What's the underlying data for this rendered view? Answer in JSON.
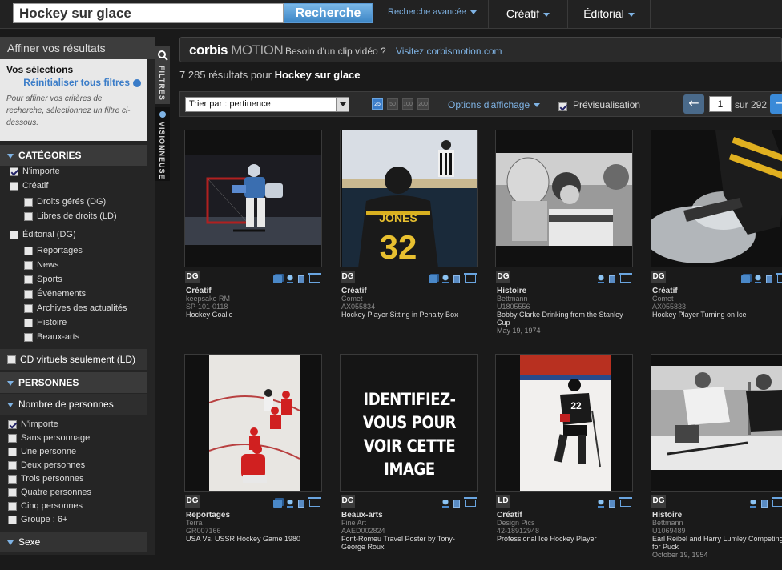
{
  "top": {
    "search_value": "Hockey sur glace",
    "search_button": "Recherche",
    "advanced": "Recherche avancée",
    "nav_creative": "Créatif",
    "nav_editorial": "Éditorial"
  },
  "sidebar": {
    "title": "Affiner vos résultats",
    "selections_title": "Vos sélections",
    "reset": "Réinitialiser tous filtres",
    "hint": "Pour affiner vos critères de recherche, sélectionnez un filtre ci-dessous.",
    "categories_head": "CATÉGORIES",
    "categories": [
      {
        "label": "N'importe",
        "checked": true
      },
      {
        "label": "Créatif",
        "checked": false
      },
      {
        "label": "Droits gérés (DG)",
        "checked": false
      },
      {
        "label": "Libres de droits (LD)",
        "checked": false
      },
      {
        "label": "Éditorial (DG)",
        "checked": false
      },
      {
        "label": "Reportages",
        "checked": false
      },
      {
        "label": "News",
        "checked": false
      },
      {
        "label": "Sports",
        "checked": false
      },
      {
        "label": "Événements",
        "checked": false
      },
      {
        "label": "Archives des actualités",
        "checked": false
      },
      {
        "label": "Histoire",
        "checked": false
      },
      {
        "label": "Beaux-arts",
        "checked": false
      }
    ],
    "cd_label": "CD virtuels seulement (LD)",
    "people_head": "PERSONNES",
    "people_count_head": "Nombre de personnes",
    "people": [
      {
        "label": "N'importe",
        "checked": true
      },
      {
        "label": "Sans personnage",
        "checked": false
      },
      {
        "label": "Une personne",
        "checked": false
      },
      {
        "label": "Deux personnes",
        "checked": false
      },
      {
        "label": "Trois personnes",
        "checked": false
      },
      {
        "label": "Quatre personnes",
        "checked": false
      },
      {
        "label": "Cinq personnes",
        "checked": false
      },
      {
        "label": "Groupe : 6+",
        "checked": false
      }
    ],
    "sex_head": "Sexe",
    "tab_filters": "FILTRES",
    "tab_viewer": "VISIONNEUSE"
  },
  "motion": {
    "brand_bold": "corbis",
    "brand_light": "MOTION",
    "need": "Besoin d'un clip vidéo ?",
    "visit": "Visitez corbismotion.com"
  },
  "results": {
    "count": "7 285",
    "mid": "résultats pour",
    "query": "Hockey sur glace"
  },
  "toolbar": {
    "sort": "Trier par : pertinence",
    "per_page": [
      "25",
      "50",
      "100",
      "200"
    ],
    "per_page_selected": "25",
    "display_options": "Options d'affichage",
    "preview": "Prévisualisation",
    "preview_checked": true,
    "page": "1",
    "of": "sur 292"
  },
  "cards": [
    {
      "badge": "DG",
      "category": "Créatif",
      "source": "keepsake RM",
      "id": "SP-101-0118",
      "title": "Hockey Goalie",
      "date": "",
      "icons": [
        "stack",
        "bulb",
        "calc",
        "cart"
      ]
    },
    {
      "badge": "DG",
      "category": "Créatif",
      "source": "Comet",
      "id": "AX055834",
      "title": "Hockey Player Sitting in Penalty Box",
      "date": "",
      "icons": [
        "stack",
        "bulb",
        "calc",
        "cart"
      ]
    },
    {
      "badge": "DG",
      "category": "Histoire",
      "source": "Bettmann",
      "id": "U1805556",
      "title": "Bobby Clarke Drinking from the Stanley Cup",
      "date": "May 19, 1974",
      "icons": [
        "bulb",
        "calc",
        "cart"
      ]
    },
    {
      "badge": "DG",
      "category": "Créatif",
      "source": "Comet",
      "id": "AX055833",
      "title": "Hockey Player Turning on Ice",
      "date": "",
      "icons": [
        "stack",
        "bulb",
        "calc",
        "cart"
      ]
    },
    {
      "badge": "DG",
      "category": "Reportages",
      "source": "Terra",
      "id": "GR007166",
      "title": "USA Vs. USSR Hockey Game 1980",
      "date": "",
      "icons": [
        "stack",
        "bulb",
        "calc",
        "cart"
      ]
    },
    {
      "badge": "DG",
      "category": "Beaux-arts",
      "source": "Fine Art",
      "id": "AAED002824",
      "title": "Font-Romeu Travel Poster by Tony-George Roux",
      "date": "",
      "icons": [
        "bulb",
        "calc",
        "cart"
      ],
      "locked_text": "IDENTIFIEZ-VOUS POUR VOIR CETTE IMAGE"
    },
    {
      "badge": "LD",
      "category": "Créatif",
      "source": "Design Pics",
      "id": "42-18912948",
      "title": "Professional Ice Hockey Player",
      "date": "",
      "icons": [
        "bulb",
        "calc",
        "cart"
      ]
    },
    {
      "badge": "DG",
      "category": "Histoire",
      "source": "Bettmann",
      "id": "U1069489",
      "title": "Earl Reibel and Harry Lumley Competing for Puck",
      "date": "October 19, 1954",
      "icons": [
        "bulb",
        "calc",
        "cart"
      ]
    }
  ],
  "photo_jerseys": {
    "card2_name": "JONES",
    "card2_number": "32",
    "card7_number": "22"
  }
}
